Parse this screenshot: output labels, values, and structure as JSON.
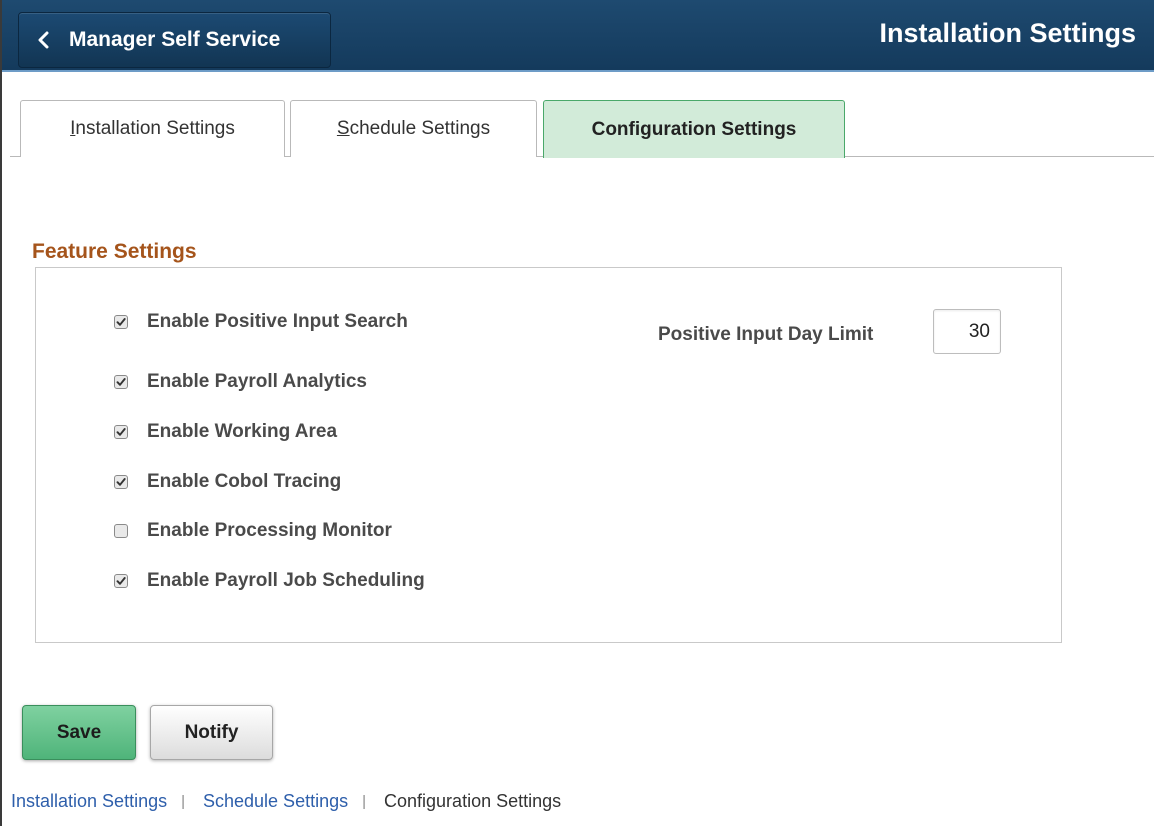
{
  "header": {
    "back_label": "Manager Self Service",
    "back_icon": "chevron-left-icon",
    "page_title": "Installation Settings",
    "bar_color": "#1a4368"
  },
  "tabs": [
    {
      "label_first": "I",
      "label_rest": "nstallation Settings",
      "active": false
    },
    {
      "label_first": "S",
      "label_rest": "chedule Settings",
      "active": false
    },
    {
      "label": "Configuration Settings",
      "active": true
    }
  ],
  "feature_settings": {
    "title": "Feature Settings",
    "checkboxes": [
      {
        "label": "Enable Positive Input Search",
        "checked": true
      },
      {
        "label": "Enable Payroll Analytics",
        "checked": true
      },
      {
        "label": "Enable Working Area",
        "checked": true
      },
      {
        "label": "Enable Cobol Tracing",
        "checked": true
      },
      {
        "label": "Enable Processing Monitor",
        "checked": false
      },
      {
        "label": "Enable Payroll Job Scheduling",
        "checked": true
      }
    ],
    "day_limit": {
      "label": "Positive Input Day Limit",
      "value": "30"
    }
  },
  "actions": {
    "save_label": "Save",
    "notify_label": "Notify",
    "save_color": "#5cbf86"
  },
  "footer_links": {
    "installation": "Installation Settings",
    "schedule": "Schedule Settings",
    "configuration": "Configuration Settings",
    "separator": "|"
  }
}
